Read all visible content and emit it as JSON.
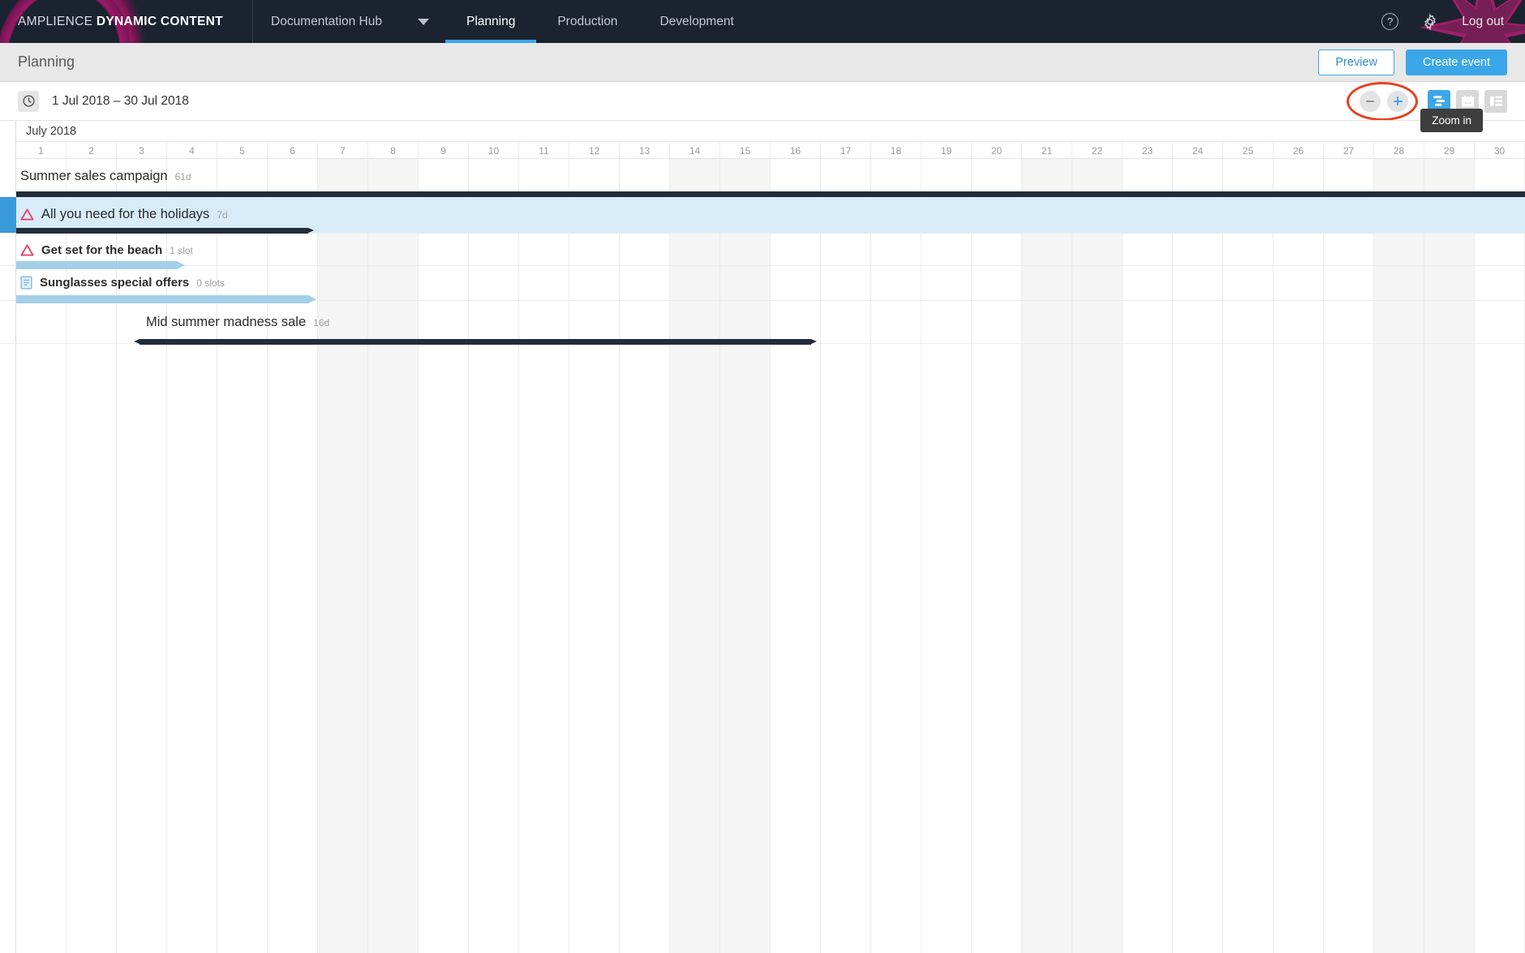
{
  "topnav": {
    "brand_light": "AMPLIENCE ",
    "brand_bold": "DYNAMIC CONTENT",
    "hub_label": "Documentation Hub",
    "hub_caret_icon": "chevron-down-icon",
    "tabs": [
      {
        "label": "Planning",
        "active": true
      },
      {
        "label": "Production",
        "active": false
      },
      {
        "label": "Development",
        "active": false
      }
    ],
    "help_icon": "question-circle-icon",
    "settings_icon": "gear-icon",
    "logout_label": "Log out"
  },
  "subheader": {
    "title": "Planning",
    "preview_label": "Preview",
    "create_event_label": "Create event"
  },
  "toolbar": {
    "clock_icon": "clock-icon",
    "date_range": "1 Jul 2018 – 30 Jul 2018",
    "zoom_out_icon": "minus-icon",
    "zoom_in_icon": "plus-icon",
    "tooltip": "Zoom in",
    "views": [
      {
        "name": "gantt-view-button",
        "icon": "gantt-icon",
        "active": true
      },
      {
        "name": "calendar-view-button",
        "icon": "calendar-icon",
        "active": false
      },
      {
        "name": "list-view-button",
        "icon": "list-icon",
        "active": false
      }
    ],
    "highlight_color": "#e8401f",
    "accent_color": "#3ba7e8"
  },
  "timeline": {
    "month_label": "July 2018",
    "days": [
      1,
      2,
      3,
      4,
      5,
      6,
      7,
      8,
      9,
      10,
      11,
      12,
      13,
      14,
      15,
      16,
      17,
      18,
      19,
      20,
      21,
      22,
      23,
      24,
      25,
      26,
      27,
      28,
      29,
      30
    ],
    "weekend_days": [
      7,
      8,
      14,
      15,
      21,
      22,
      28,
      29
    ]
  },
  "events": [
    {
      "title": "Summer sales campaign",
      "meta": "61d",
      "icon": null,
      "bold": false,
      "selected": false,
      "bar_type": "dark",
      "bar_start_day": 1,
      "bar_end_day": 31,
      "bar_arrow_end": false,
      "bar_arrow_start": false,
      "label_left_day": 1
    },
    {
      "title": "All you need for the holidays",
      "meta": "7d",
      "icon": "warning-triangle-icon",
      "bold": false,
      "selected": true,
      "bar_type": "dark",
      "bar_start_day": 1,
      "bar_end_day": 6.8,
      "bar_arrow_end": true,
      "bar_arrow_start": false,
      "label_left_day": 1
    },
    {
      "title": "Get set for the beach",
      "meta": "1 slot",
      "icon": "warning-triangle-icon",
      "bold": true,
      "selected": false,
      "bar_type": "light",
      "bar_start_day": 1,
      "bar_end_day": 4.2,
      "bar_arrow_end": true,
      "bar_arrow_start": false,
      "label_left_day": 1
    },
    {
      "title": "Sunglasses special offers",
      "meta": "0 slots",
      "icon": "document-icon",
      "bold": true,
      "selected": false,
      "bar_type": "light",
      "bar_start_day": 1,
      "bar_end_day": 6.8,
      "bar_arrow_end": true,
      "bar_arrow_start": false,
      "label_left_day": 1
    },
    {
      "title": "Mid summer madness sale",
      "meta": "16d",
      "icon": null,
      "bold": false,
      "selected": false,
      "bar_type": "dark",
      "bar_start_day": 3.45,
      "bar_end_day": 16.8,
      "bar_arrow_end": true,
      "bar_arrow_start": true,
      "label_left_day": 3.5
    }
  ]
}
